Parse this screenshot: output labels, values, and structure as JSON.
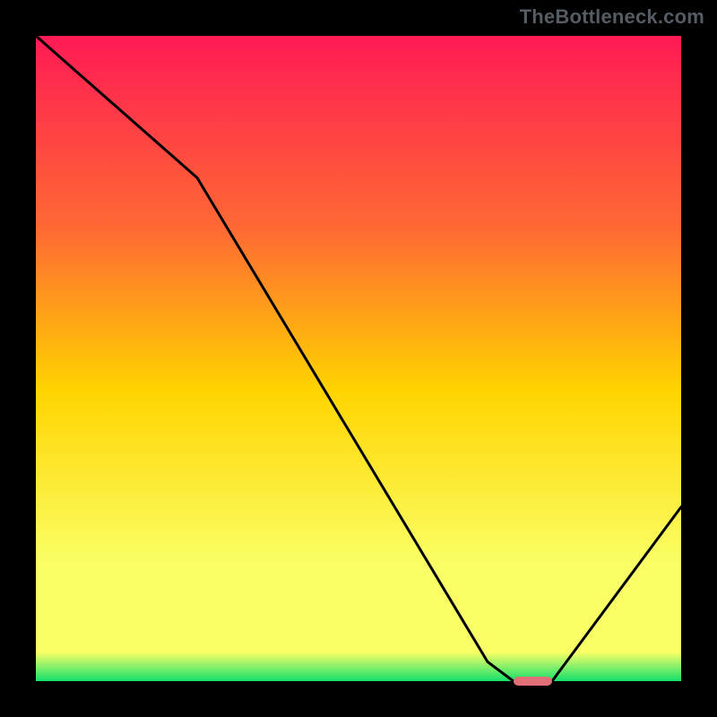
{
  "watermark": "TheBottleneck.com",
  "colors": {
    "bg": "#000000",
    "grad_top": "#ff1a55",
    "grad_upper": "#ff6a33",
    "grad_mid": "#ffd400",
    "grad_lower": "#faff66",
    "grad_bottom": "#13e06c",
    "curve": "#000000",
    "marker": "#e26f75"
  },
  "chart_data": {
    "type": "line",
    "title": "",
    "xlabel": "",
    "ylabel": "",
    "xlim": [
      0,
      100
    ],
    "ylim": [
      0,
      100
    ],
    "series": [
      {
        "name": "bottleneck-curve",
        "x": [
          0,
          25,
          70,
          74,
          80,
          100
        ],
        "values": [
          100,
          78,
          3,
          0,
          0,
          27
        ]
      }
    ],
    "marker": {
      "x_start": 74,
      "x_end": 80,
      "y": 0
    }
  }
}
